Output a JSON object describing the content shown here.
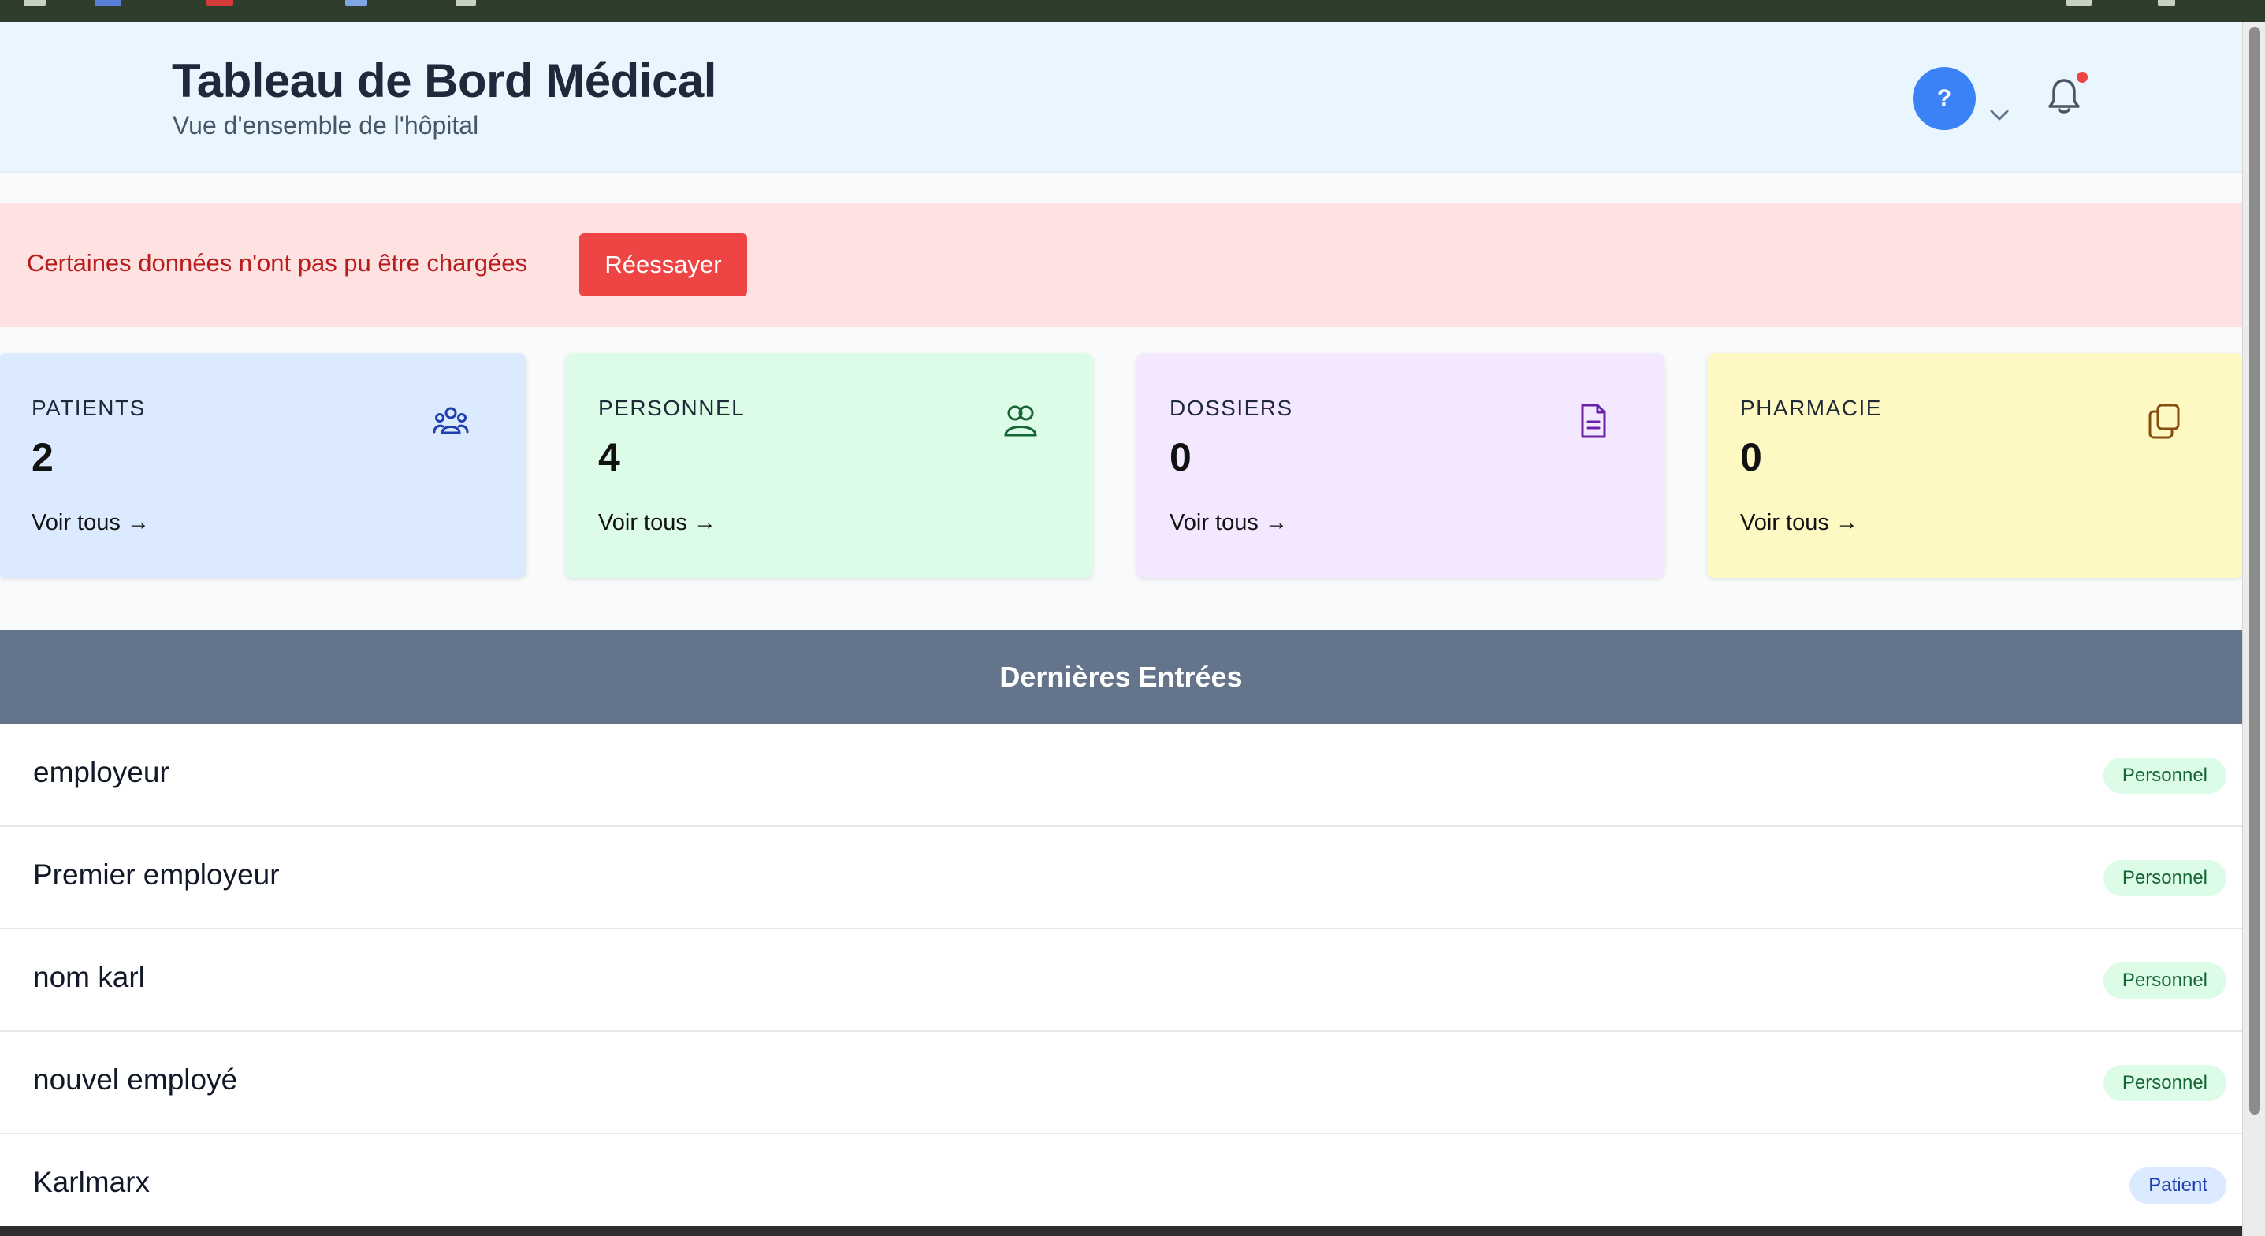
{
  "header": {
    "title": "Tableau de Bord Médical",
    "subtitle": "Vue d'ensemble de l'hôpital",
    "avatar_label": "?"
  },
  "error": {
    "message": "Certaines données n'ont pas pu être chargées",
    "retry_label": "Réessayer"
  },
  "stats": [
    {
      "label": "PATIENTS",
      "value": "2",
      "link": "Voir tous →",
      "bg": "#dbeafe",
      "icon": "users-group-icon",
      "icon_color": "#1e40af"
    },
    {
      "label": "PERSONNEL",
      "value": "4",
      "link": "Voir tous →",
      "bg": "#dcfce7",
      "icon": "user-pair-icon",
      "icon_color": "#166534"
    },
    {
      "label": "DOSSIERS",
      "value": "0",
      "link": "Voir tous →",
      "bg": "#f3e8ff",
      "icon": "document-icon",
      "icon_color": "#6b21a8"
    },
    {
      "label": "PHARMACIE",
      "value": "0",
      "link": "Voir tous →",
      "bg": "#fef9c3",
      "icon": "copy-icon",
      "icon_color": "#854d0e"
    }
  ],
  "recent": {
    "title": "Dernières Entrées",
    "entries": [
      {
        "name": "employeur",
        "badge": "Personnel"
      },
      {
        "name": "Premier employeur",
        "badge": "Personnel"
      },
      {
        "name": "nom karl",
        "badge": "Personnel"
      },
      {
        "name": "nouvel employé",
        "badge": "Personnel"
      },
      {
        "name": "Karlmarx",
        "badge": "Patient"
      }
    ]
  },
  "colors": {
    "header_bg": "#e9f6fd",
    "accent_blue": "#3b82f6",
    "error_bg": "#fee2e2",
    "error_text": "#b91c1c",
    "retry_bg": "#ef4444",
    "section_header_bg": "#64748b",
    "badge_personnel_bg": "#dcfce7",
    "badge_personnel_text": "#166534",
    "badge_patient_bg": "#dbeafe",
    "badge_patient_text": "#1e40af"
  }
}
